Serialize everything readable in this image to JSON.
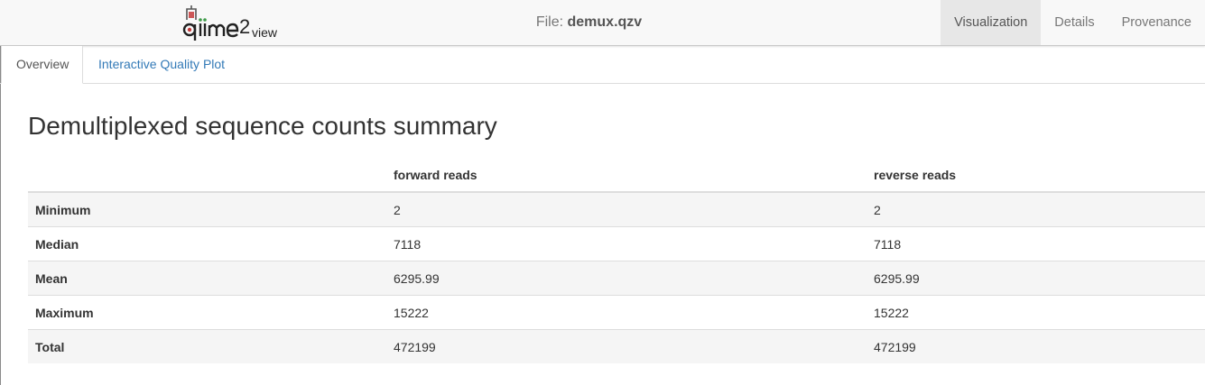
{
  "navbar": {
    "logo_text": "qiime2view",
    "file_label": "File:",
    "file_name": "demux.qzv",
    "items": [
      {
        "label": "Visualization",
        "active": true
      },
      {
        "label": "Details",
        "active": false
      },
      {
        "label": "Provenance",
        "active": false
      }
    ]
  },
  "tabs": [
    {
      "label": "Overview",
      "active": true
    },
    {
      "label": "Interactive Quality Plot",
      "active": false
    }
  ],
  "main": {
    "title": "Demultiplexed sequence counts summary",
    "table": {
      "headers": [
        "",
        "forward reads",
        "reverse reads"
      ],
      "rows": [
        {
          "label": "Minimum",
          "forward": "2",
          "reverse": "2"
        },
        {
          "label": "Median",
          "forward": "7118",
          "reverse": "7118"
        },
        {
          "label": "Mean",
          "forward": "6295.99",
          "reverse": "6295.99"
        },
        {
          "label": "Maximum",
          "forward": "15222",
          "reverse": "15222"
        },
        {
          "label": "Total",
          "forward": "472199",
          "reverse": "472199"
        }
      ]
    }
  },
  "colors": {
    "link": "#337ab7",
    "navbar_bg": "#f8f8f8",
    "active_nav_bg": "#e7e7e7",
    "logo_red": "#c43b3b",
    "logo_green": "#3f9b4a"
  }
}
